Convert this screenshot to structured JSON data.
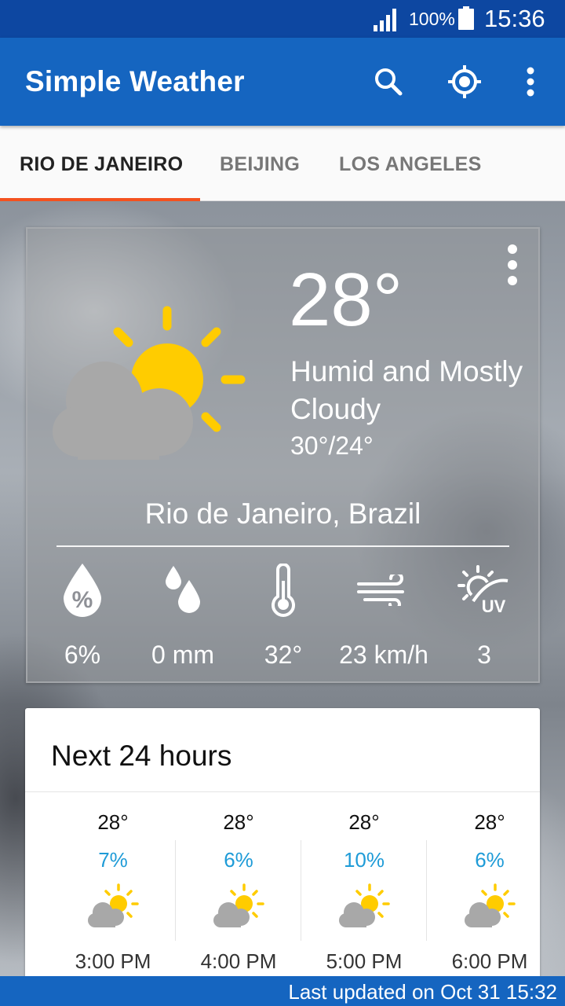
{
  "status_bar": {
    "battery": "100%",
    "time": "15:36"
  },
  "app_bar": {
    "title": "Simple Weather",
    "icons": [
      "search-icon",
      "my-location-icon",
      "more-vert-icon"
    ]
  },
  "tabs": [
    {
      "label": "RIO DE JANEIRO",
      "active": true
    },
    {
      "label": "BEIJING",
      "active": false
    },
    {
      "label": "LOS ANGELES",
      "active": false
    }
  ],
  "current": {
    "temperature": "28°",
    "condition": "Humid and Mostly Cloudy",
    "high_low": "30°/24°",
    "location": "Rio de Janeiro, Brazil",
    "icon": "partly-cloudy-icon",
    "stats": [
      {
        "icon": "humidity-icon",
        "value": "6%"
      },
      {
        "icon": "precipitation-icon",
        "value": "0 mm"
      },
      {
        "icon": "thermometer-icon",
        "value": "32°"
      },
      {
        "icon": "wind-icon",
        "value": "23 km/h"
      },
      {
        "icon": "uv-index-icon",
        "value": "3"
      }
    ]
  },
  "hourly": {
    "title": "Next 24 hours",
    "items": [
      {
        "temp": "28°",
        "rain": "7%",
        "time": "3:00 PM",
        "icon": "partly-cloudy-icon"
      },
      {
        "temp": "28°",
        "rain": "6%",
        "time": "4:00 PM",
        "icon": "partly-cloudy-icon"
      },
      {
        "temp": "28°",
        "rain": "10%",
        "time": "5:00 PM",
        "icon": "partly-cloudy-icon"
      },
      {
        "temp": "28°",
        "rain": "6%",
        "time": "6:00 PM",
        "icon": "partly-cloudy-icon"
      }
    ]
  },
  "footer": {
    "last_updated": "Last updated on Oct 31 15:32"
  },
  "colors": {
    "status_bar": "#0d47a1",
    "app_bar": "#1565c0",
    "tab_indicator": "#f4511e",
    "sun": "#ffcc00",
    "cloud": "#a6a6a6",
    "rain_percent": "#1e9bd7"
  }
}
